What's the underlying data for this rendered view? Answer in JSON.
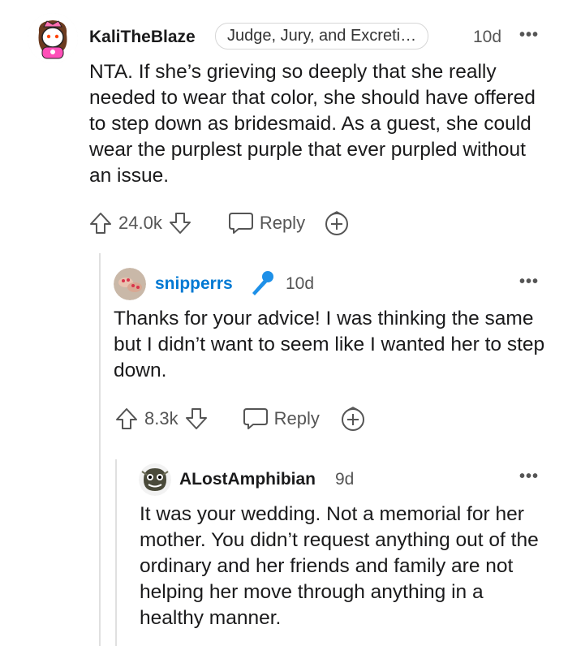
{
  "comments": [
    {
      "username": "KaliTheBlaze",
      "flair": "Judge, Jury, and Excreti…",
      "time": "10d",
      "body": "NTA. If she’s grieving so deeply that she really needed to wear that color, she should have offered to step down as bridesmaid. As a guest, she could wear the purplest purple that ever purpled without an issue.",
      "votes": "24.0k",
      "reply_label": "Reply"
    },
    {
      "username": "snipperrs",
      "is_op": true,
      "time": "10d",
      "body": "Thanks for your advice! I was thinking the same but I didn’t want to seem like I wanted her to step down.",
      "votes": "8.3k",
      "reply_label": "Reply"
    },
    {
      "username": "ALostAmphibian",
      "time": "9d",
      "body": "It was your wedding. Not a memorial for her mother. You didn’t request anything out of the ordinary and her friends and family are not helping her move through anything in a healthy manner."
    }
  ],
  "icons": {
    "upvote": "arrow-up-icon",
    "downvote": "arrow-down-icon",
    "reply": "speech-bubble-icon",
    "award": "plus-circle-icon",
    "op_badge": "microphone-icon",
    "more": "ellipsis-icon"
  },
  "colors": {
    "op_username": "#0079d3",
    "text": "#1a1a1b",
    "muted": "#555555",
    "thread_line": "#e0e0e0"
  }
}
